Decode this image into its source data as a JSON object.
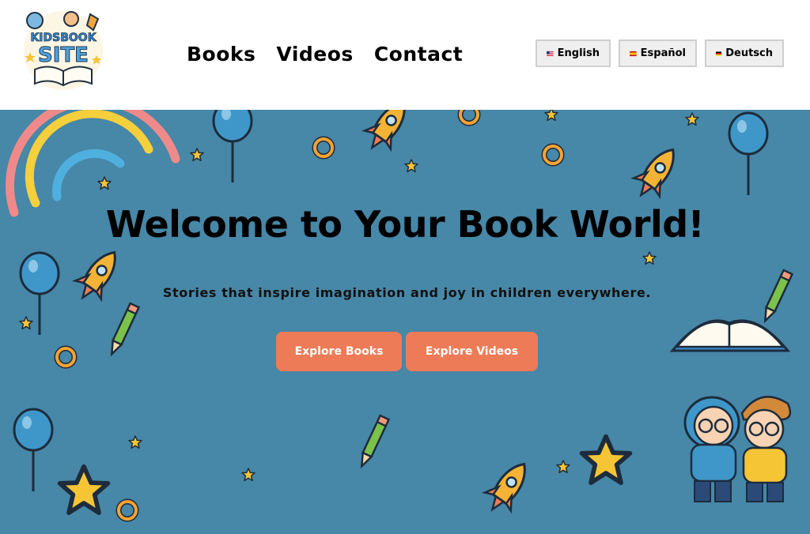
{
  "brand": {
    "logo_line1": "KIDSBOOK",
    "logo_line2": "SITE"
  },
  "nav": {
    "books": "Books",
    "videos": "Videos",
    "contact": "Contact"
  },
  "languages": [
    {
      "label": "English",
      "flag": "us-flag-icon"
    },
    {
      "label": "Español",
      "flag": "es-flag-icon"
    },
    {
      "label": "Deutsch",
      "flag": "de-flag-icon"
    }
  ],
  "hero": {
    "title": "Welcome to Your Book World!",
    "subtitle": "Stories that inspire imagination and joy in children everywhere.",
    "cta_books": "Explore Books",
    "cta_videos": "Explore Videos"
  },
  "colors": {
    "hero_bg": "#4787a7",
    "cta": "#ee7b57",
    "star": "#f5c535",
    "balloon": "#3f97c9"
  }
}
